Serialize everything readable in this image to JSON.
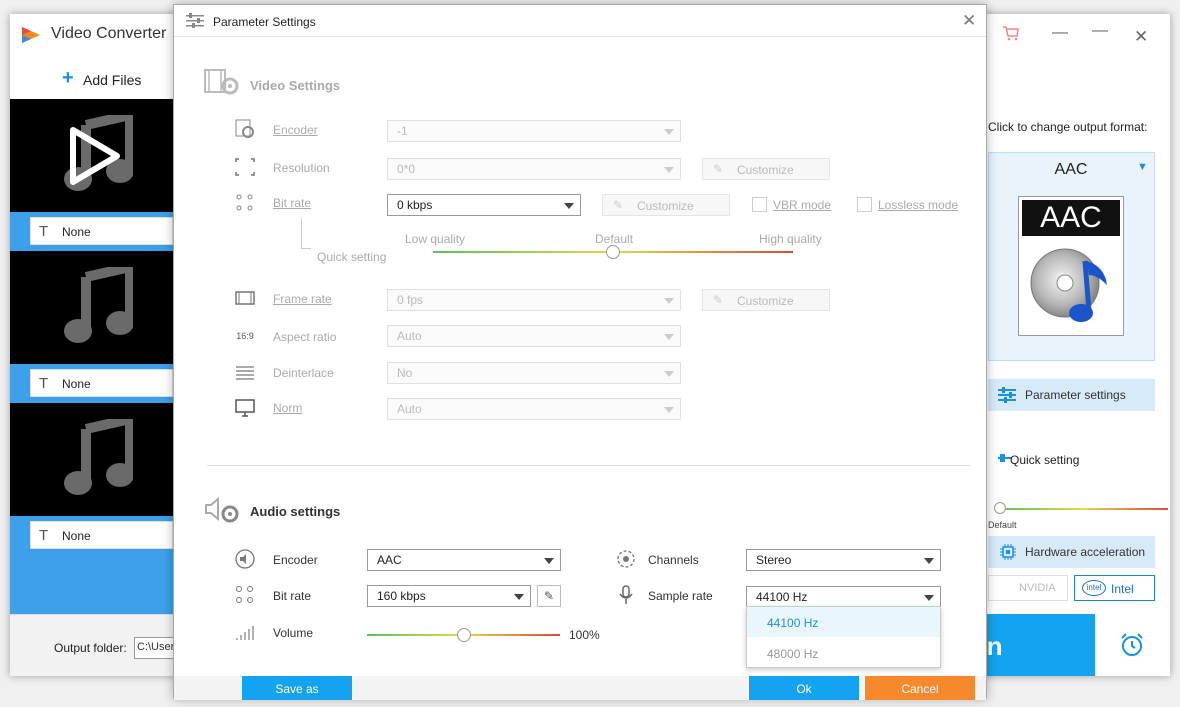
{
  "app": {
    "title": "Video Converter",
    "add_files": "Add Files",
    "items": [
      {
        "subtitle": "None"
      },
      {
        "subtitle": "None"
      },
      {
        "subtitle": "None"
      }
    ],
    "output_folder_label": "Output folder:",
    "output_folder_value": "C:\\Users",
    "run_label": "Run"
  },
  "right_panel": {
    "hint": "Click to change output format:",
    "format_name": "AAC",
    "format_icon_text": "AAC",
    "parameter_settings": "Parameter settings",
    "quick_setting": "Quick setting",
    "quick_default": "Default",
    "hardware_acceleration": "Hardware acceleration",
    "nvidia": "NVIDIA",
    "intel": "Intel"
  },
  "dialog": {
    "title": "Parameter Settings",
    "video": {
      "section_title": "Video Settings",
      "encoder_label": "Encoder",
      "encoder_value": "-1",
      "resolution_label": "Resolution",
      "resolution_value": "0*0",
      "resolution_customize": "Customize",
      "bitrate_label": "Bit rate",
      "bitrate_value": "0 kbps",
      "bitrate_customize": "Customize",
      "vbr_mode": "VBR mode",
      "lossless_mode": "Lossless mode",
      "quick_setting": "Quick setting",
      "quality_low": "Low quality",
      "quality_default": "Default",
      "quality_high": "High quality",
      "quality_level": 0.5,
      "framerate_label": "Frame rate",
      "framerate_value": "0 fps",
      "framerate_customize": "Customize",
      "aspect_label": "Aspect ratio",
      "aspect_value": "Auto",
      "aspect_icon_text": "16:9",
      "deinterlace_label": "Deinterlace",
      "deinterlace_value": "No",
      "norm_label": "Norm",
      "norm_value": "Auto"
    },
    "audio": {
      "section_title": "Audio settings",
      "encoder_label": "Encoder",
      "encoder_value": "AAC",
      "channels_label": "Channels",
      "channels_value": "Stereo",
      "bitrate_label": "Bit rate",
      "bitrate_value": "160 kbps",
      "samplerate_label": "Sample rate",
      "samplerate_value": "44100 Hz",
      "samplerate_options": [
        "44100 Hz",
        "48000 Hz"
      ],
      "volume_label": "Volume",
      "volume_value": "100%",
      "volume_level": 0.5
    },
    "buttons": {
      "save_as": "Save as",
      "ok": "Ok",
      "cancel": "Cancel"
    }
  },
  "colors": {
    "accent_blue": "#13a3f1",
    "cancel_orange": "#f5892b",
    "sidebar_blue": "#3da0e9"
  }
}
